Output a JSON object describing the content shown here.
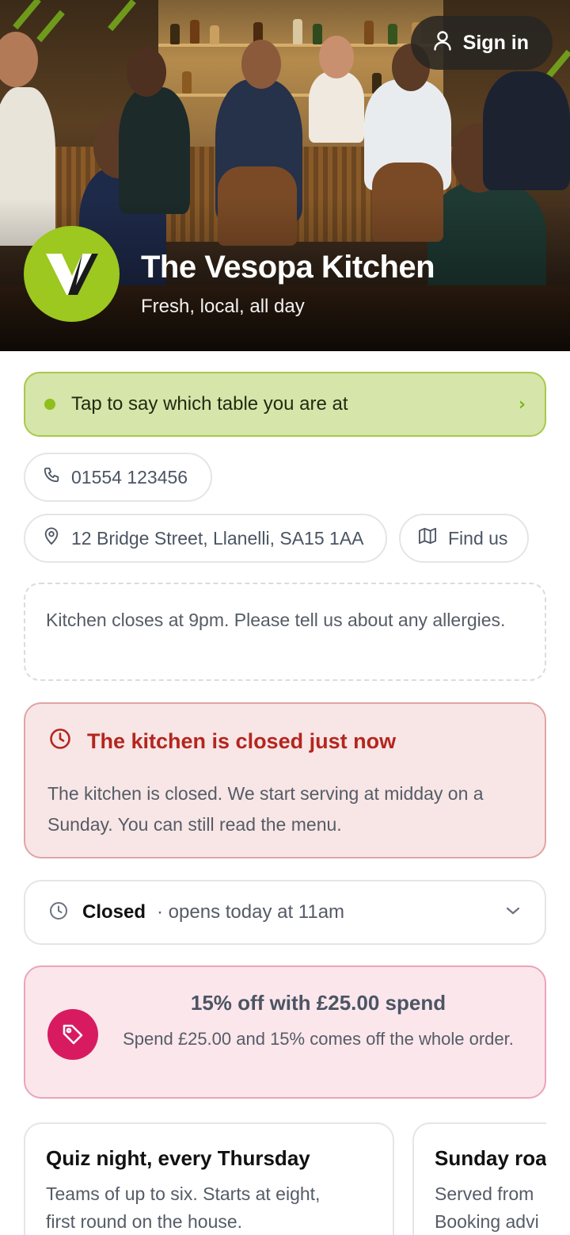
{
  "header": {
    "sign_in_label": "Sign in",
    "venue_name": "The Vesopa Kitchen",
    "tagline": "Fresh, local, all day",
    "logo_letter": "V",
    "brand_color": "#9cc81f"
  },
  "table_prompt": {
    "label": "Tap to say which table you are at"
  },
  "contact": {
    "phone": "01554 123456",
    "address": "12 Bridge Street, Llanelli, SA15 1AA",
    "find_us_label": "Find us"
  },
  "note": "Kitchen closes at 9pm. Please tell us about any allergies.",
  "kitchen_status": {
    "title": "The kitchen is closed just now",
    "body": "The kitchen is closed. We start serving at midday on a Sunday. You can still read the menu.",
    "accent": "#b3261e"
  },
  "hours": {
    "state": "Closed",
    "detail": "· opens today at 11am"
  },
  "offer": {
    "title": "15% off with £25.00 spend",
    "body": "Spend £25.00 and 15% comes off the whole order.",
    "accent": "#d81b60"
  },
  "events": [
    {
      "title": "Quiz night, every Thursday",
      "line1": "Teams of up to six. Starts at eight,",
      "line2": "first round on the house."
    },
    {
      "title": "Sunday roa",
      "line1": "Served from",
      "line2": "Booking advi"
    }
  ]
}
